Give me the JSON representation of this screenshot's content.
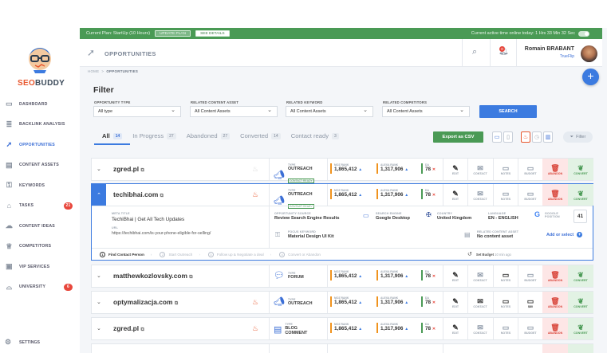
{
  "sidebar": {
    "brand": {
      "part1": "SEO",
      "part2": "BUDDY"
    },
    "items": [
      {
        "label": "DASHBOARD",
        "icon": "monitor-icon",
        "glyph": "▭",
        "badge": ""
      },
      {
        "label": "BACKLINK ANALYSIS",
        "icon": "chart-bars-icon",
        "glyph": "≣",
        "badge": ""
      },
      {
        "label": "OPPORTUNITIES",
        "icon": "rocket-icon",
        "glyph": "➚",
        "badge": ""
      },
      {
        "label": "CONTENT ASSETS",
        "icon": "document-icon",
        "glyph": "▤",
        "badge": ""
      },
      {
        "label": "KEYWORDS",
        "icon": "key-icon",
        "glyph": "⚿",
        "badge": ""
      },
      {
        "label": "TASKS",
        "icon": "tag-icon",
        "glyph": "⌂",
        "badge": "21"
      },
      {
        "label": "CONTENT IDEAS",
        "icon": "chat-icon",
        "glyph": "☁",
        "badge": ""
      },
      {
        "label": "COMPETITORS",
        "icon": "trophy-icon",
        "glyph": "♕",
        "badge": ""
      },
      {
        "label": "VIP SERVICES",
        "icon": "id-card-icon",
        "glyph": "▣",
        "badge": ""
      },
      {
        "label": "UNIVERSITY",
        "icon": "graduation-cap-icon",
        "glyph": "⌓",
        "badge": "6"
      }
    ],
    "settings": "SETTINGS"
  },
  "topbar": {
    "plan": "Current Plan: StartUp (10 Hours)",
    "update_btn": "UPDATE PLAN",
    "details_btn": "SEE DETAILS",
    "time": "Current active time online today: 1 Hrs 33 Min 32 Sec"
  },
  "header": {
    "title": "OPPORTUNITIES",
    "notif_count": "0",
    "user_name": "Romain BRABANT",
    "user_company": "TrueFlip"
  },
  "breadcrumb": {
    "home": "HOME",
    "sep": ">",
    "current": "OPPORTUNITIES"
  },
  "filter": {
    "title": "Filter",
    "fields": [
      {
        "label": "OPPORTUNITY TYPE",
        "value": "All type"
      },
      {
        "label": "RELATED CONTENT ASSET",
        "value": "All Content Assets"
      },
      {
        "label": "RELATED KEYWORD",
        "value": "All Content Assets"
      },
      {
        "label": "RELATED COMPETITORS",
        "value": "All Content Assets"
      }
    ],
    "search": "SEARCH"
  },
  "tabs": [
    {
      "label": "All",
      "count": "14"
    },
    {
      "label": "In Progress",
      "count": "27"
    },
    {
      "label": "Abandoned",
      "count": "27"
    },
    {
      "label": "Converted",
      "count": "14"
    },
    {
      "label": "Contact ready",
      "count": "3"
    }
  ],
  "toolbar": {
    "export": "Export as CSV",
    "filter": "Filter"
  },
  "metric_labels": {
    "moz": "MOZ RANK",
    "alexa": "ALEXA RANK",
    "da": "DA"
  },
  "cell_labels": {
    "edit": "EDIT",
    "contact": "CONTACT",
    "notes": "NOTES",
    "budget": "BUDGET",
    "abandon": "ABANDON",
    "convert": "CONVERT"
  },
  "rows": [
    {
      "domain": "zgred.pl",
      "hot": false,
      "type_label": "TYPE",
      "type": "OUTREACH",
      "type_tag": "CONTACT READY",
      "moz": "1,865,412",
      "alexa": "1,317,906",
      "da": "78",
      "budget": ""
    },
    {
      "domain": "techibhai.com",
      "hot": true,
      "type_label": "TYPE",
      "type": "OUTREACH",
      "type_tag": "CONTACT READY",
      "moz": "1,865,412",
      "alexa": "1,317,906",
      "da": "78",
      "budget": ""
    },
    {
      "domain": "matthewkozlovsky.com",
      "hot": false,
      "type_label": "TYPE",
      "type": "FORUM",
      "type_tag": "",
      "moz": "1,865,412",
      "alexa": "1,317,906",
      "da": "78",
      "budget": ""
    },
    {
      "domain": "optymalizacja.com",
      "hot": true,
      "type_label": "TYPE",
      "type": "OUTREACH",
      "type_tag": "",
      "moz": "1,865,412",
      "alexa": "1,317,906",
      "da": "78",
      "budget": "$80"
    },
    {
      "domain": "zgred.pl",
      "hot": true,
      "type_label": "TYPE",
      "type": "BLOG",
      "type2": "COMMENT",
      "type_tag": "",
      "moz": "1,865,412",
      "alexa": "1,317,906",
      "da": "78",
      "budget": ""
    }
  ],
  "detail": {
    "meta_title_label": "META TITLE",
    "meta_title": "TechiBhai | Get All Tech Updates",
    "url_label": "URL",
    "url": "https://techibhai.com/is-your-phone-eligible-for-selling/",
    "source_label": "OPPORTUNITY SOURCE",
    "source": "Review Search Engine Results",
    "engine_label": "SEARCH ENGINE",
    "engine": "Google Desktop",
    "country_label": "COUNTRY",
    "country": "United Kingdom",
    "language_label": "LANGUAGE",
    "language": "EN - ENGLISH",
    "google_label": "GOOGLE POSITION",
    "google_pos": "41",
    "keyword_label": "FOCUS KEYWORD",
    "keyword": "Material Design UI Kit",
    "asset_label": "RELATED CONTENT ASSET",
    "asset": "No content asset",
    "add_select": "Add or select",
    "steps": [
      "Find Contact Person",
      "Start Outreach",
      "Follow up & Negotiate a deal",
      "Convert or Abandon"
    ],
    "set_budget": "Set Budget",
    "set_budget_time": "10 min ago"
  },
  "colors": {
    "accent": "#3c7be0",
    "green": "#4a9a55",
    "red": "#e8473c",
    "orange": "#e8572e"
  }
}
